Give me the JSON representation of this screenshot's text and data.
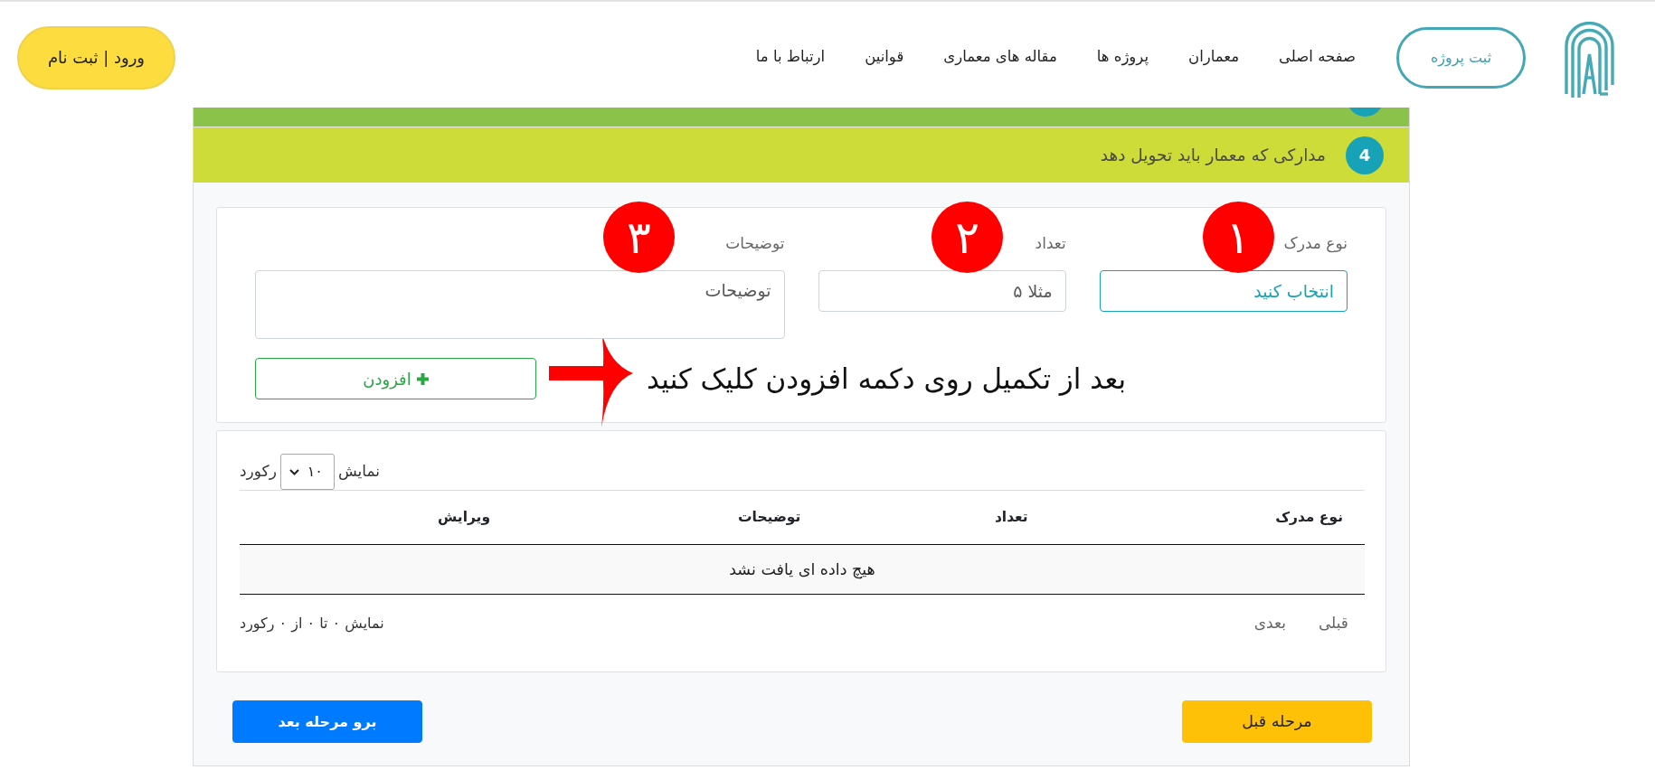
{
  "navbar": {
    "submit_button": "ثبت پروژه",
    "links": [
      "صفحه اصلی",
      "معماران",
      "پروژه ها",
      "مقاله های معماری",
      "قوانین",
      "ارتباط با ما"
    ],
    "login_button": "ورود | ثبت نام"
  },
  "steps": [
    {
      "color": "#8bc34a"
    },
    {
      "number": "4",
      "title": "مدارکی که معمار باید تحویل دهد",
      "color": "#cddc39"
    }
  ],
  "form": {
    "fields": [
      {
        "kind": "select",
        "label": "نوع مدرک",
        "value": "انتخاب کنید",
        "callout": "۱"
      },
      {
        "kind": "input",
        "label": "تعداد",
        "placeholder": "مثلا ۵",
        "callout": "۲"
      },
      {
        "kind": "textarea",
        "label": "توضیحات",
        "placeholder": "توضیحات",
        "callout": "۳"
      }
    ],
    "add_button": "افزودن",
    "note": "بعد از تکمیل روی دکمه افزودن کلیک کنید"
  },
  "table": {
    "length": {
      "prefix": "نمایش",
      "value": "۱۰",
      "suffix": "رکورد"
    },
    "columns": [
      "نوع مدرک",
      "تعداد",
      "توضیحات",
      "ویرایش"
    ],
    "empty_message": "هیچ داده ای یافت نشد",
    "info": "نمایش ۰ تا ۰ از ۰ رکورد",
    "pagination": [
      "قبلی",
      "بعدی"
    ]
  },
  "footer_buttons": [
    {
      "kind": "previous",
      "label": "مرحله قبل"
    },
    {
      "kind": "next",
      "label": "برو مرحله بعد"
    }
  ]
}
